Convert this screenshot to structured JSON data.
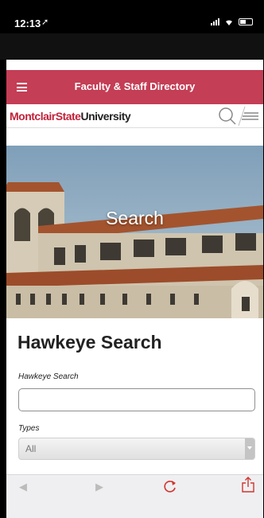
{
  "status_bar": {
    "time": "12:13"
  },
  "app_bar": {
    "title": "Faculty & Staff Directory"
  },
  "site_header": {
    "logo_part1": "MontclairState",
    "logo_part2": "University"
  },
  "hero": {
    "title": "Search"
  },
  "form": {
    "heading": "Hawkeye Search",
    "search_label": "Hawkeye Search",
    "search_value": "",
    "types_label": "Types",
    "types_selected": "All"
  },
  "toolbar": {
    "back_icon": "back-arrow-icon",
    "forward_icon": "forward-arrow-icon",
    "reload_icon": "reload-icon",
    "share_icon": "share-icon"
  },
  "colors": {
    "brand_red": "#c43e55",
    "logo_red": "#c0223a",
    "accent_border": "#c4283f"
  }
}
